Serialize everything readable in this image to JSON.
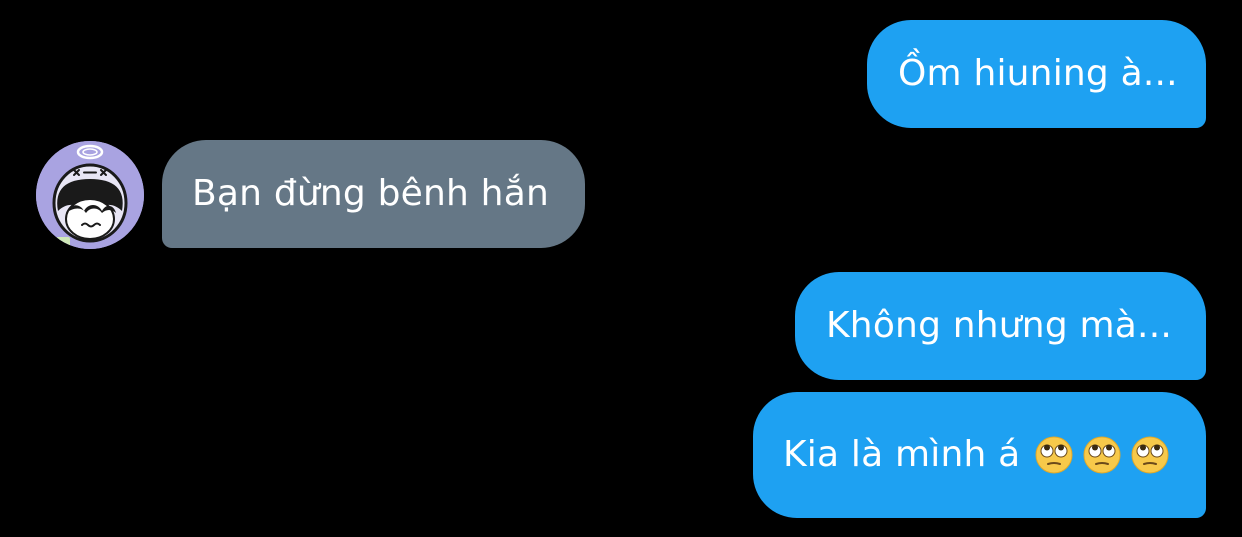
{
  "messages": [
    {
      "id": "msg-1",
      "direction": "outgoing",
      "text": "Ồm hiuning à..."
    },
    {
      "id": "msg-2",
      "direction": "incoming",
      "text": "Bạn đừng bênh hắn"
    },
    {
      "id": "msg-3",
      "direction": "outgoing",
      "text": "Không nhưng mà..."
    },
    {
      "id": "msg-4",
      "direction": "outgoing",
      "text": "Kia là mình á",
      "emoji": [
        "face-with-rolling-eyes-icon",
        "face-with-rolling-eyes-icon",
        "face-with-rolling-eyes-icon"
      ]
    }
  ],
  "colors": {
    "background": "#000000",
    "outgoing_bubble": "#1ea1f2",
    "incoming_bubble": "#657786",
    "text": "#ffffff",
    "avatar_bg": "#a9a3e1"
  },
  "avatar": {
    "icon": "avatar"
  }
}
